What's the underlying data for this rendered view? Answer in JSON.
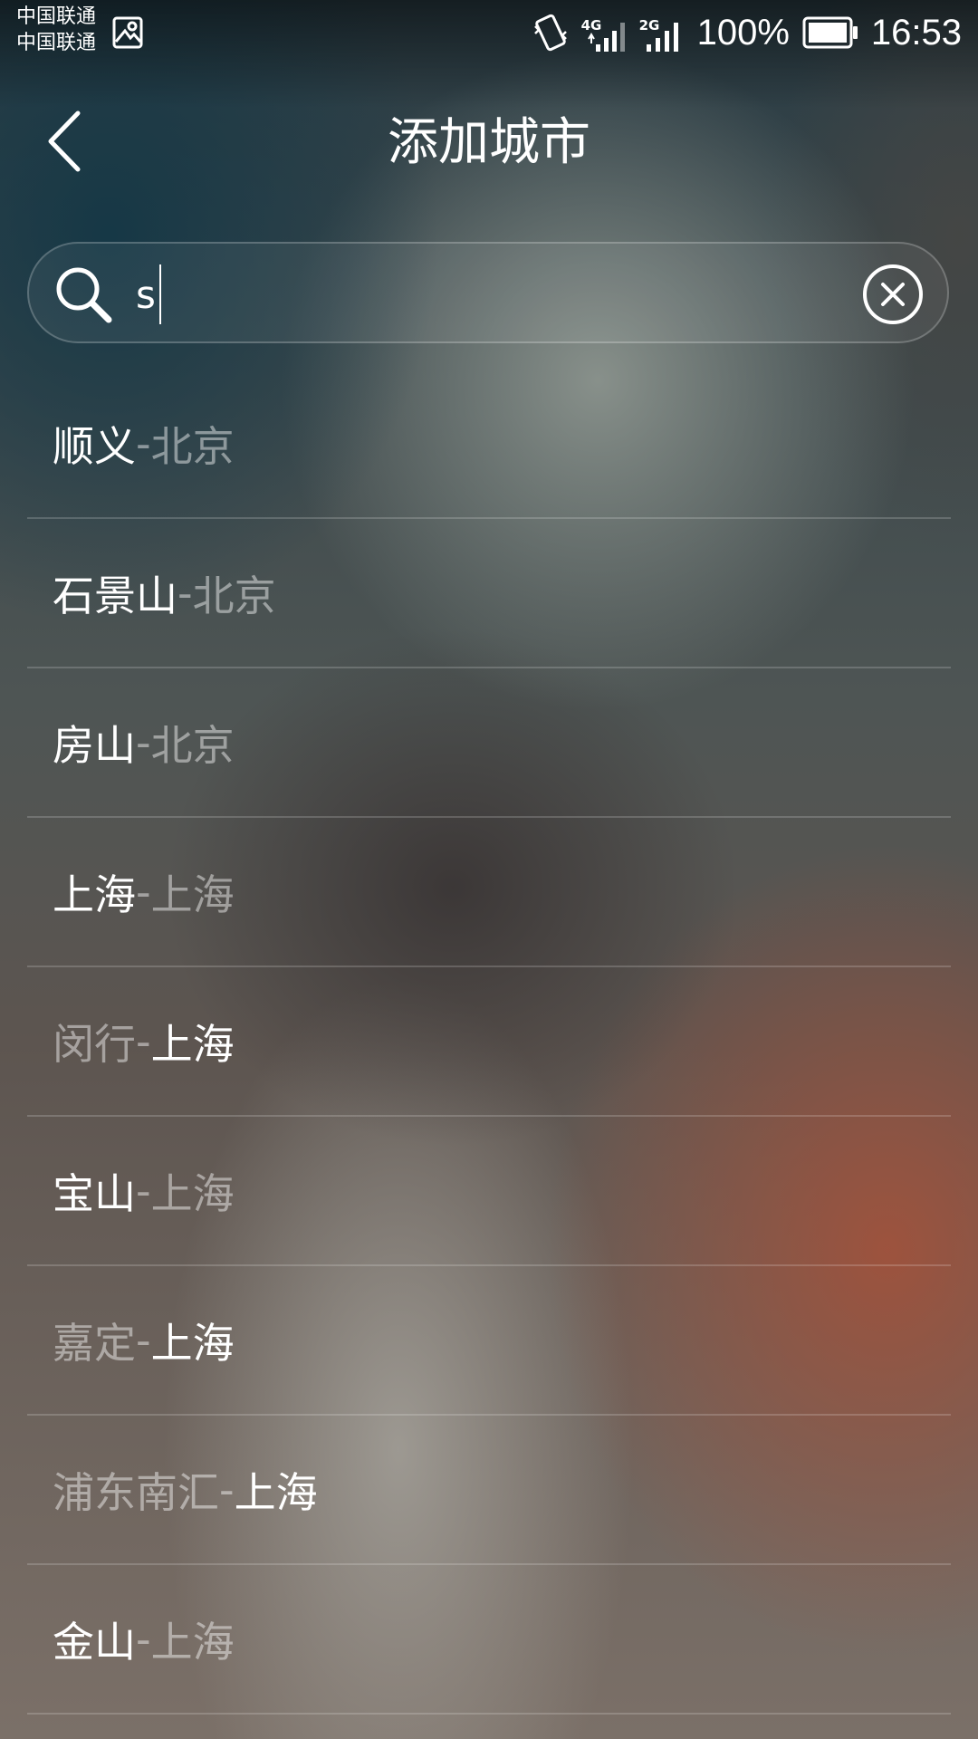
{
  "status_bar": {
    "carrier_1": "中国联通",
    "carrier_2": "中国联通",
    "network_1": "4G",
    "network_2": "2G",
    "battery_percent": "100%",
    "time": "16:53"
  },
  "header": {
    "title": "添加城市"
  },
  "search": {
    "value": "s"
  },
  "cities": [
    {
      "name": "顺义",
      "separator": " - ",
      "region": "北京",
      "highlight": "name"
    },
    {
      "name": "石景山",
      "separator": " - ",
      "region": "北京",
      "highlight": "name"
    },
    {
      "name": "房山",
      "separator": " - ",
      "region": "北京",
      "highlight": "name"
    },
    {
      "name": "上海",
      "separator": " - ",
      "region": "上海",
      "highlight": "name"
    },
    {
      "name": "闵行",
      "separator": " - ",
      "region": "上海",
      "highlight": "region"
    },
    {
      "name": "宝山",
      "separator": " - ",
      "region": "上海",
      "highlight": "name"
    },
    {
      "name": "嘉定",
      "separator": " - ",
      "region": "上海",
      "highlight": "region"
    },
    {
      "name": "浦东南汇",
      "separator": " - ",
      "region": "上海",
      "highlight": "region"
    },
    {
      "name": "金山",
      "separator": " - ",
      "region": "上海",
      "highlight": "name"
    }
  ]
}
